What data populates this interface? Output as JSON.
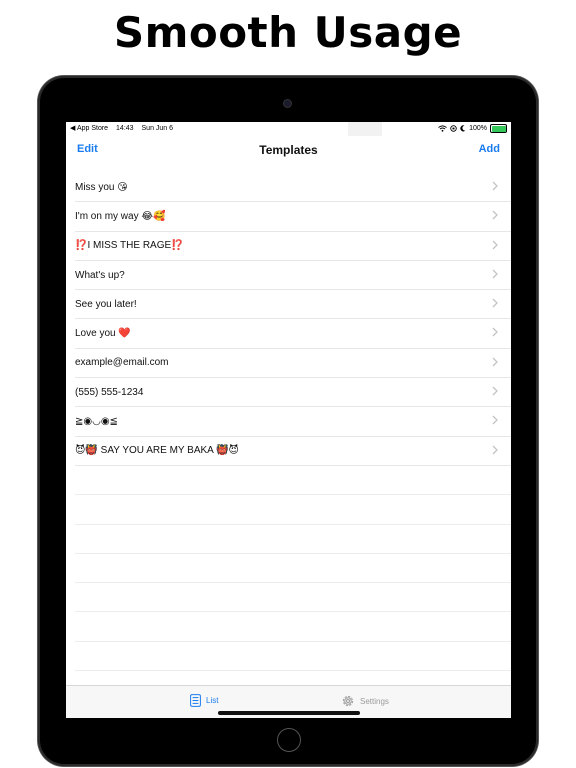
{
  "headline": "Smooth Usage",
  "status_bar": {
    "back_app": "◀ App Store",
    "time": "14:43",
    "date": "Sun Jun 6",
    "battery_percent": "100%"
  },
  "navbar": {
    "edit_label": "Edit",
    "title": "Templates",
    "add_label": "Add"
  },
  "templates": [
    {
      "text": "Miss you 😘"
    },
    {
      "text": "I'm on my way 😂🥰"
    },
    {
      "text": "⁉️I MISS THE RAGE⁉️"
    },
    {
      "text": "What's up?"
    },
    {
      "text": "See you later!"
    },
    {
      "text": "Love you ❤️"
    },
    {
      "text": "example@email.com"
    },
    {
      "text": "(555) 555-1234"
    },
    {
      "text": "≧◉◡◉≦"
    },
    {
      "text": "😈👹 SAY YOU ARE MY BAKA 👹😈"
    }
  ],
  "tabbar": {
    "list_label": "List",
    "settings_label": "Settings"
  },
  "colors": {
    "accent": "#1a7cf0",
    "inactive_tab": "#9a9a9a",
    "separator": "#e6e6e6"
  },
  "icons": {
    "list_tab": "list-icon",
    "settings_tab": "gear-icon",
    "row_disclosure": "chevron-right-icon"
  }
}
